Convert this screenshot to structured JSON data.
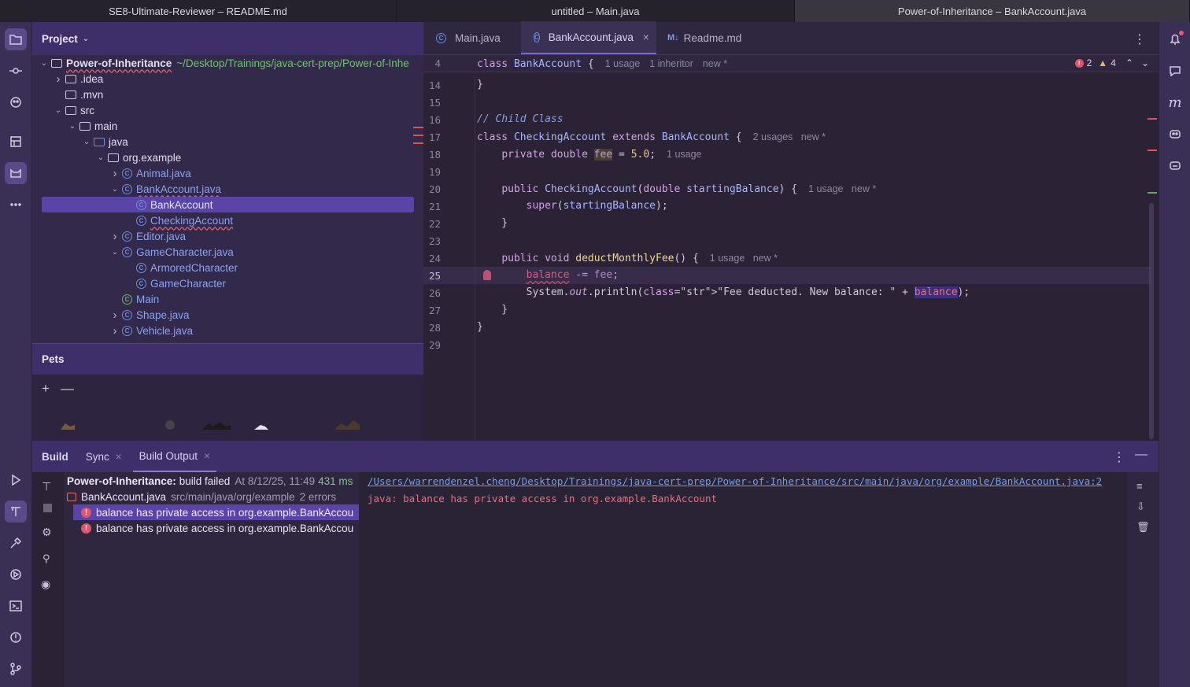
{
  "window_tabs": [
    "SE8-Ultimate-Reviewer – README.md",
    "untitled – Main.java",
    "Power-of-Inheritance – BankAccount.java"
  ],
  "project_panel": {
    "title": "Project",
    "tree": [
      {
        "label": "Power-of-Inheritance",
        "path": "~/Desktop/Trainings/java-cert-prep/Power-of-Inhe",
        "depth": 0,
        "chev": "down",
        "icon": "module"
      },
      {
        "label": ".idea",
        "depth": 1,
        "chev": "right",
        "icon": "folder"
      },
      {
        "label": ".mvn",
        "depth": 1,
        "chev": "",
        "icon": "folder"
      },
      {
        "label": "src",
        "depth": 1,
        "chev": "down",
        "icon": "folder"
      },
      {
        "label": "main",
        "depth": 2,
        "chev": "down",
        "icon": "folder"
      },
      {
        "label": "java",
        "depth": 3,
        "chev": "down",
        "icon": "folder-blue"
      },
      {
        "label": "org.example",
        "depth": 4,
        "chev": "down",
        "icon": "package"
      },
      {
        "label": "Animal.java",
        "depth": 5,
        "chev": "right",
        "icon": "class"
      },
      {
        "label": "BankAccount.java",
        "depth": 5,
        "chev": "down",
        "icon": "class",
        "error": true
      },
      {
        "label": "BankAccount",
        "depth": 6,
        "chev": "",
        "icon": "class",
        "selected": true
      },
      {
        "label": "CheckingAccount",
        "depth": 6,
        "chev": "",
        "icon": "class",
        "error": true
      },
      {
        "label": "Editor.java",
        "depth": 5,
        "chev": "right",
        "icon": "class"
      },
      {
        "label": "GameCharacter.java",
        "depth": 5,
        "chev": "down",
        "icon": "class"
      },
      {
        "label": "ArmoredCharacter",
        "depth": 6,
        "chev": "",
        "icon": "class"
      },
      {
        "label": "GameCharacter",
        "depth": 6,
        "chev": "",
        "icon": "class"
      },
      {
        "label": "Main",
        "depth": 5,
        "chev": "",
        "icon": "class-main"
      },
      {
        "label": "Shape.java",
        "depth": 5,
        "chev": "right",
        "icon": "class"
      },
      {
        "label": "Vehicle.java",
        "depth": 5,
        "chev": "right",
        "icon": "class"
      }
    ]
  },
  "pets_panel": {
    "title": "Pets",
    "add": "+",
    "remove": "—"
  },
  "editor": {
    "tabs": [
      {
        "label": "Main.java",
        "icon": "C"
      },
      {
        "label": "BankAccount.java",
        "icon": "C",
        "active": true,
        "close": "×"
      },
      {
        "label": "Readme.md",
        "icon": "M↓"
      }
    ],
    "sticky": {
      "line": "4",
      "kw": "class",
      "name": "BankAccount",
      "brace": "{",
      "hint1": "1 usage",
      "hint2": "1 inheritor",
      "hint3": "new *"
    },
    "errors_count": "2",
    "warnings_count": "4",
    "lines": [
      {
        "n": "14",
        "code": "}"
      },
      {
        "n": "15",
        "code": ""
      },
      {
        "n": "16",
        "code": "// Child Class"
      },
      {
        "n": "17",
        "code": "class CheckingAccount extends BankAccount {",
        "hint": "2 usages   new *"
      },
      {
        "n": "18",
        "code": "    private double fee = 5.0;",
        "hint": "1 usage"
      },
      {
        "n": "19",
        "code": ""
      },
      {
        "n": "20",
        "code": "    public CheckingAccount(double startingBalance) {",
        "hint": "1 usage   new *"
      },
      {
        "n": "21",
        "code": "        super(startingBalance);"
      },
      {
        "n": "22",
        "code": "    }"
      },
      {
        "n": "23",
        "code": ""
      },
      {
        "n": "24",
        "code": "    public void deductMonthlyFee() {",
        "hint": "1 usage   new *"
      },
      {
        "n": "25",
        "code": "        balance -= fee;"
      },
      {
        "n": "26",
        "code": "        System.out.println(\"Fee deducted. New balance: \" + balance);"
      },
      {
        "n": "27",
        "code": "    }"
      },
      {
        "n": "28",
        "code": "}"
      },
      {
        "n": "29",
        "code": ""
      }
    ]
  },
  "build_panel": {
    "tabs": [
      {
        "label": "Build"
      },
      {
        "label": "Sync",
        "close": "×"
      },
      {
        "label": "Build Output",
        "close": "×",
        "active": true
      }
    ],
    "summary": {
      "title": "Power-of-Inheritance:",
      "status": "build failed",
      "time": "At 8/12/25, 11:49",
      "duration": "431 ms"
    },
    "file": {
      "name": "BankAccount.java",
      "path": "src/main/java/org/example",
      "errors": "2 errors"
    },
    "errors": [
      "balance has private access in org.example.BankAccou",
      "balance has private access in org.example.BankAccou"
    ],
    "output_link": "/Users/warrendenzel.cheng/Desktop/Trainings/java-cert-prep/Power-of-Inheritance/src/main/java/org/example/BankAccount.java:2",
    "output_message": "java: balance has private access in org.example.BankAccount"
  }
}
